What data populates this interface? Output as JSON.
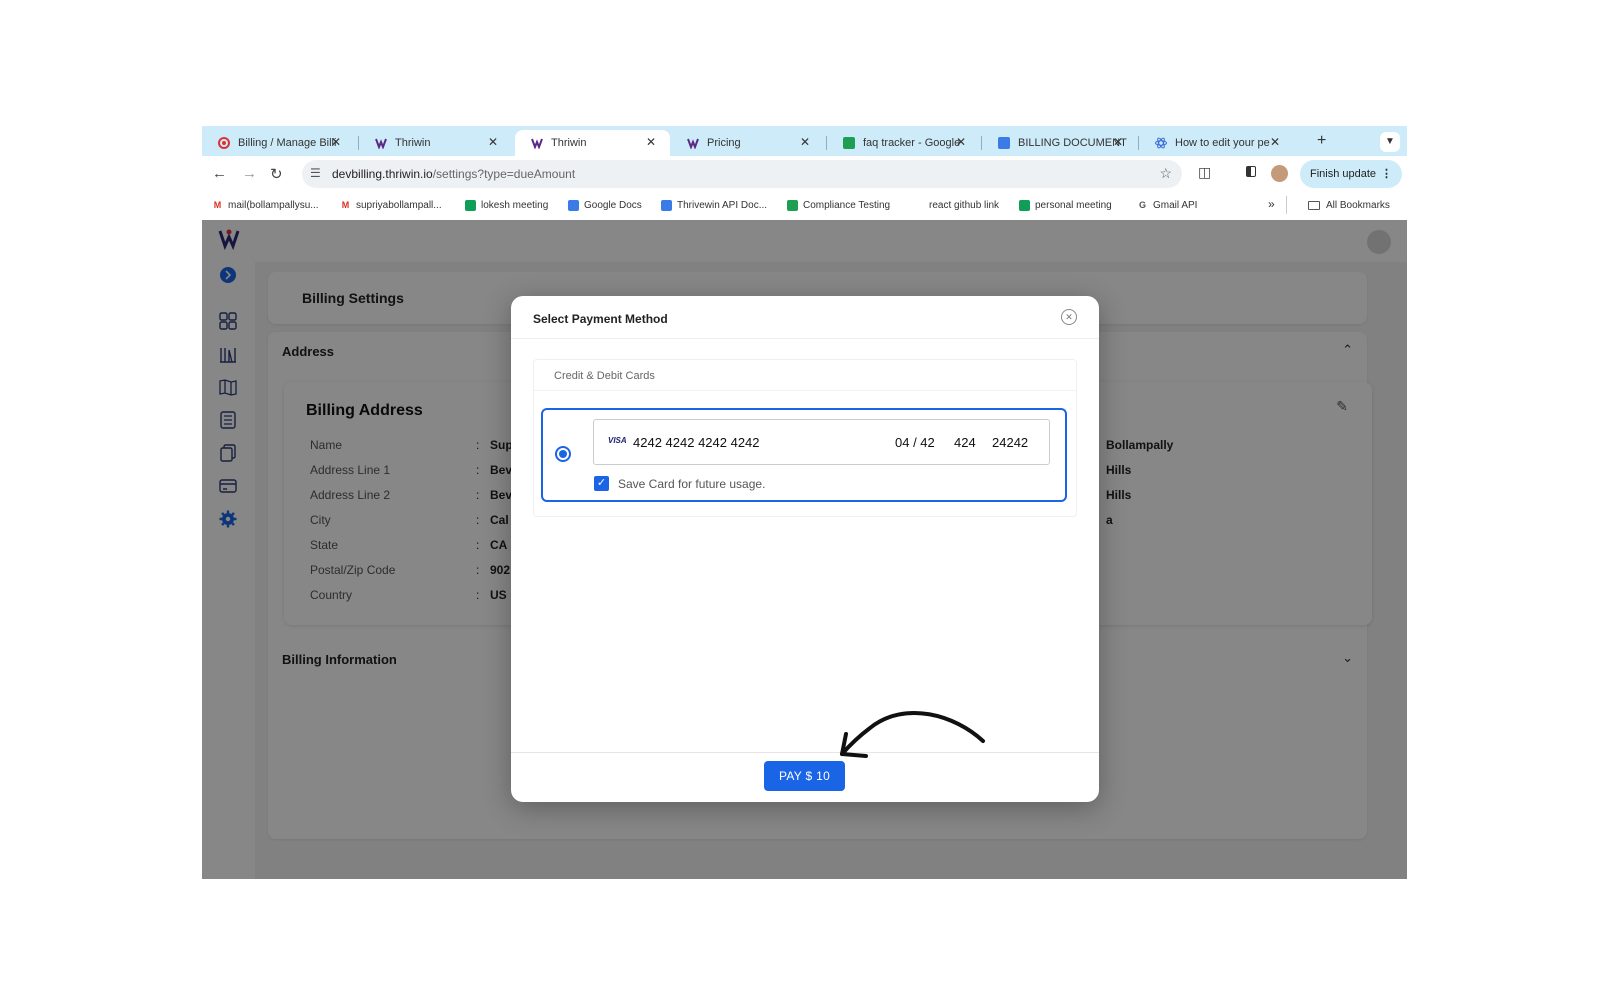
{
  "browser": {
    "tabs": [
      {
        "title": "Billing / Manage Billi",
        "icon": "red-circle-icon",
        "active": false
      },
      {
        "title": "Thriwin",
        "icon": "thriwin-logo-icon",
        "active": false
      },
      {
        "title": "Thriwin",
        "icon": "thriwin-logo-icon",
        "active": true
      },
      {
        "title": "Pricing",
        "icon": "thriwin-logo-icon",
        "active": false
      },
      {
        "title": "faq tracker - Google",
        "icon": "google-sheets-icon",
        "active": false
      },
      {
        "title": "BILLING DOCUMENT",
        "icon": "google-docs-icon",
        "active": false
      },
      {
        "title": "How to edit your pe",
        "icon": "react-icon",
        "active": false
      }
    ],
    "tab_close_glyph": "✕",
    "new_tab_glyph": "+",
    "url_host": "devbilling.thriwin.io",
    "url_path": "/settings?type=dueAmount",
    "finish_update_label": "Finish update",
    "bookmarks": [
      {
        "label": "mail(bollampallysu...",
        "icon": "gmail-icon"
      },
      {
        "label": "supriyabollampall...",
        "icon": "gmail-icon"
      },
      {
        "label": "lokesh meeting",
        "icon": "google-meet-icon"
      },
      {
        "label": "Google Docs",
        "icon": "google-docs-icon"
      },
      {
        "label": "Thrivewin API Doc...",
        "icon": "google-docs-icon"
      },
      {
        "label": "Compliance Testing",
        "icon": "google-sheets-icon"
      },
      {
        "label": "react github link",
        "icon": ""
      },
      {
        "label": "personal meeting",
        "icon": "google-meet-icon"
      },
      {
        "label": "Gmail API",
        "icon": "google-icon"
      }
    ],
    "bookmarks_overflow": "»",
    "all_bookmarks_label": "All Bookmarks"
  },
  "page": {
    "title": "Billing Settings",
    "address_section_label": "Address",
    "billing_info_section_label": "Billing Information",
    "billing_address": {
      "heading": "Billing Address",
      "rows": [
        {
          "label": "Name",
          "value": "Sup",
          "value2": "Bollampally"
        },
        {
          "label": "Address Line 1",
          "value": "Bev",
          "value2": "Hills"
        },
        {
          "label": "Address Line 2",
          "value": "Bev",
          "value2": "Hills"
        },
        {
          "label": "City",
          "value": "Cal",
          "value2": "a"
        },
        {
          "label": "State",
          "value": "CA",
          "value2": ""
        },
        {
          "label": "Postal/Zip Code",
          "value": "902",
          "value2": ""
        },
        {
          "label": "Country",
          "value": "US",
          "value2": ""
        }
      ]
    }
  },
  "modal": {
    "title": "Select Payment Method",
    "cards_section_label": "Credit & Debit Cards",
    "card": {
      "brand": "VISA",
      "number": "4242 4242 4242 4242",
      "expiry": "04 / 42",
      "cvc": "424",
      "zip": "24242"
    },
    "save_card_label": "Save Card for future usage.",
    "save_card_checked": true,
    "pay_button_label": "PAY $ 10"
  },
  "colors": {
    "accent": "#1a64e6",
    "tabstrip": "#cdebf8",
    "overlay": "rgba(0,0,0,0.47)"
  }
}
